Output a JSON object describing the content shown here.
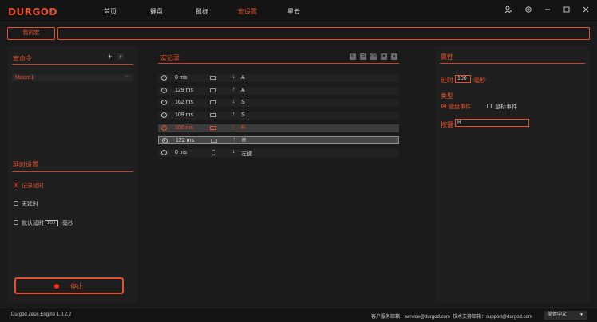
{
  "brand": {
    "logo": "DURGOD"
  },
  "nav": [
    "首页",
    "键盘",
    "鼠标",
    "宏设置",
    "星云"
  ],
  "nav_active": "宏设置",
  "tabs": {
    "my_macro": "我的宏",
    "macro_name_value": ""
  },
  "left": {
    "title": "宏命令",
    "add_icon": "+",
    "macros": [
      {
        "name": "Macro1",
        "more": "···"
      }
    ],
    "delay_title": "延时设置",
    "delay_options": [
      {
        "label": "记录延时",
        "selected": true
      },
      {
        "label": "无延时",
        "selected": false
      },
      {
        "label": "默认延时",
        "selected": false
      }
    ],
    "default_delay_value": "100",
    "default_delay_unit": "毫秒",
    "stop_label": "停止"
  },
  "middle": {
    "title": "宏记录",
    "records": [
      {
        "time": "0 ms",
        "device": "keyboard",
        "action": "↓",
        "key": "A",
        "state": "normal"
      },
      {
        "time": "129 ms",
        "device": "keyboard",
        "action": "↑",
        "key": "A",
        "state": "normal"
      },
      {
        "time": "162 ms",
        "device": "keyboard",
        "action": "↓",
        "key": "S",
        "state": "normal"
      },
      {
        "time": "109 ms",
        "device": "keyboard",
        "action": "↑",
        "key": "S",
        "state": "normal"
      },
      {
        "time": "100 ms",
        "device": "keyboard",
        "action": "↓",
        "key": "R",
        "state": "active"
      },
      {
        "time": "122 ms",
        "device": "keyboard",
        "action": "↑",
        "key": "R",
        "state": "selected"
      },
      {
        "time": "0 ms",
        "device": "mouse",
        "action": "↓",
        "key": "左键",
        "state": "normal"
      }
    ]
  },
  "right": {
    "title": "属性",
    "delay_label": "延时",
    "delay_value": "100",
    "delay_unit": "毫秒",
    "type_label": "类型",
    "type_keyboard": "键盘事件",
    "type_mouse": "鼠标事件",
    "key_label": "按键",
    "key_value": "R"
  },
  "status": {
    "app_version": "Durgod Zeus Engine 1.0.2.2",
    "customer_service": "客户服务邮箱：service@durgod.com",
    "tech_support": "技术支持邮箱：support@durgod.com",
    "language": "简体中文"
  },
  "colors": {
    "accent": "#e6502c",
    "background": "#1a1a1a",
    "panel": "#1f1f1f"
  }
}
